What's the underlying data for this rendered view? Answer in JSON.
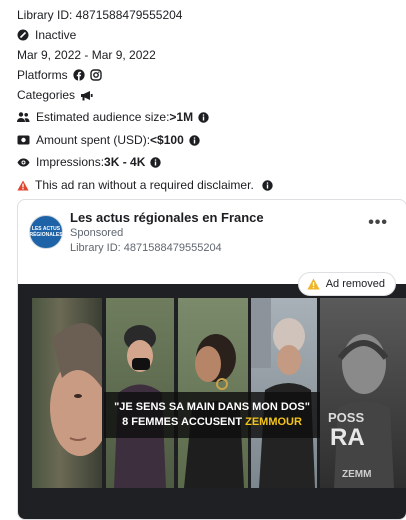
{
  "library_id": "Library ID: 4871588479555204",
  "status": "Inactive",
  "date_range": "Mar 9, 2022 - Mar 9, 2022",
  "platforms_label": "Platforms",
  "categories_label": "Categories",
  "audience": {
    "label": "Estimated audience size: ",
    "value": ">1M"
  },
  "amount": {
    "label": "Amount spent (USD): ",
    "value": "<$100"
  },
  "impressions": {
    "label": "Impressions: ",
    "value": "3K - 4K"
  },
  "disclaimer": "This ad ran without a required disclaimer.",
  "card": {
    "page_name": "Les actus régionales en France",
    "sponsored": "Sponsored",
    "library_id": "Library ID: 4871588479555204",
    "avatar_text_1": "LES ACTUS",
    "avatar_text_2": "RÉGIONALES",
    "more": "•••",
    "ad_removed": "Ad removed",
    "caption_line1": "\"JE SENS SA MAIN DANS MON DOS\"",
    "caption_line2_prefix": "8 FEMMES ACCUSENT ",
    "caption_line2_highlight": "ZEMMOUR",
    "poster_text": "POSS",
    "poster_text2": "RA",
    "poster_text3": "ZEMM"
  },
  "colors": {
    "warning": "#e0462f",
    "highlight": "#f3c41b",
    "avatar": "#1e63a8"
  }
}
